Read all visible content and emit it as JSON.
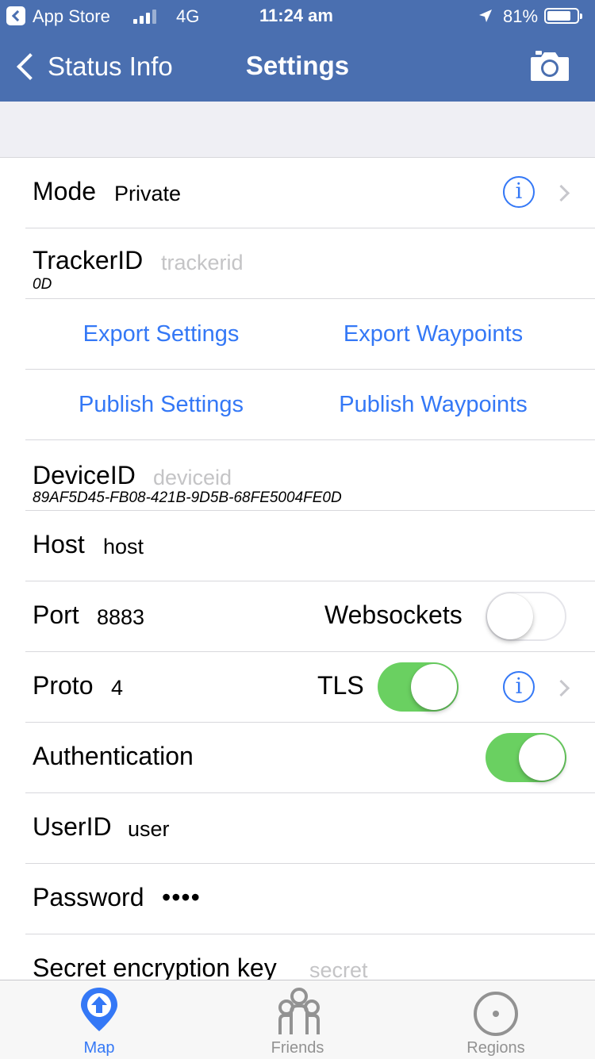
{
  "status_bar": {
    "carrier_app": "App Store",
    "network": "4G",
    "time": "11:24 am",
    "battery_percent": "81%",
    "battery_level": 0.81,
    "signal_bars": 3
  },
  "nav": {
    "back_label": "Status Info",
    "title": "Settings"
  },
  "rows": {
    "mode": {
      "label": "Mode",
      "value": "Private"
    },
    "tracker": {
      "label": "TrackerID",
      "placeholder": "trackerid",
      "sub": "0D"
    },
    "export": {
      "settings": "Export Settings",
      "waypoints": "Export Waypoints"
    },
    "publish": {
      "settings": "Publish Settings",
      "waypoints": "Publish Waypoints"
    },
    "device": {
      "label": "DeviceID",
      "placeholder": "deviceid",
      "sub": "89AF5D45-FB08-421B-9D5B-68FE5004FE0D"
    },
    "host": {
      "label": "Host",
      "value": "host"
    },
    "port": {
      "label": "Port",
      "value": "8883",
      "toggle_label": "Websockets",
      "toggle_on": false
    },
    "proto": {
      "label": "Proto",
      "value": "4",
      "toggle_label": "TLS",
      "toggle_on": true
    },
    "auth": {
      "label": "Authentication",
      "toggle_on": true
    },
    "user": {
      "label": "UserID",
      "value": "user"
    },
    "password": {
      "label": "Password",
      "value": "••••"
    },
    "secret": {
      "label": "Secret encryption key",
      "placeholder": "secret"
    }
  },
  "info_glyph": "i",
  "tabs": [
    {
      "label": "Map",
      "icon": "map-pin-icon",
      "active": true
    },
    {
      "label": "Friends",
      "icon": "friends-icon",
      "active": false
    },
    {
      "label": "Regions",
      "icon": "region-circle-icon",
      "active": false
    }
  ],
  "colors": {
    "nav_bar": "#4a6fb0",
    "accent": "#3478f6",
    "switch_on": "#6ad061",
    "inactive_tab": "#929292"
  }
}
